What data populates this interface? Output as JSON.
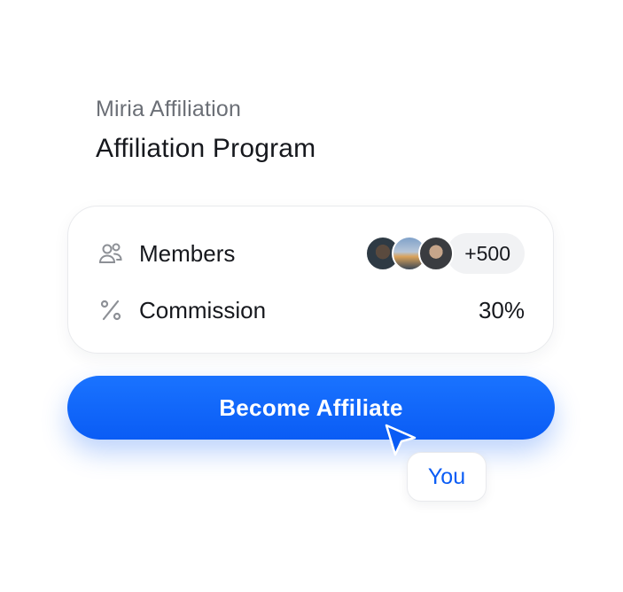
{
  "header": {
    "subtitle": "Miria Affiliation",
    "title": "Affiliation Program"
  },
  "card": {
    "members": {
      "icon": "users-icon",
      "label": "Members",
      "avatars": [
        "avatar-1",
        "avatar-2",
        "avatar-3"
      ],
      "count": "+500"
    },
    "commission": {
      "icon": "percent-icon",
      "label": "Commission",
      "value": "30%"
    }
  },
  "cta": {
    "label": "Become Affiliate"
  },
  "cursor": {
    "icon": "pointer-cursor-icon",
    "label": "You"
  },
  "colors": {
    "accent": "#0a5cf5",
    "text": "#16181d",
    "muted": "#6b6f76"
  }
}
